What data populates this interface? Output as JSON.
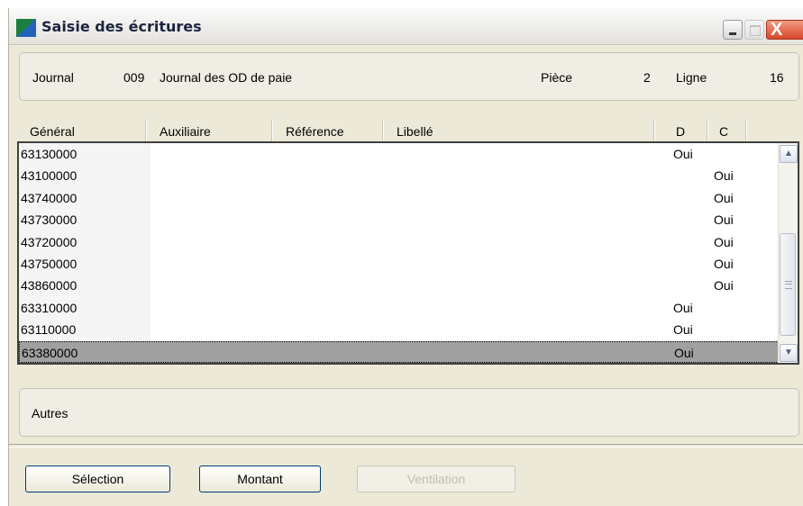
{
  "window": {
    "title": "Saisie des écritures",
    "close_glyph": "X"
  },
  "header": {
    "journal_label": "Journal",
    "journal_code": "009",
    "journal_name": "Journal des OD de paie",
    "piece_label": "Pièce",
    "piece_value": "2",
    "ligne_label": "Ligne",
    "ligne_value": "16"
  },
  "grid": {
    "columns": [
      "Général",
      "Auxiliaire",
      "Référence",
      "Libellé",
      "D",
      "C"
    ],
    "rows": [
      {
        "general": "63130000",
        "d": "Oui",
        "c": ""
      },
      {
        "general": "43100000",
        "d": "",
        "c": "Oui"
      },
      {
        "general": "43740000",
        "d": "",
        "c": "Oui"
      },
      {
        "general": "43730000",
        "d": "",
        "c": "Oui"
      },
      {
        "general": "43720000",
        "d": "",
        "c": "Oui"
      },
      {
        "general": "43750000",
        "d": "",
        "c": "Oui"
      },
      {
        "general": "43860000",
        "d": "",
        "c": "Oui"
      },
      {
        "general": "63310000",
        "d": "Oui",
        "c": ""
      },
      {
        "general": "63110000",
        "d": "Oui",
        "c": ""
      },
      {
        "general": "63380000",
        "d": "Oui",
        "c": ""
      }
    ],
    "selected_row": 9
  },
  "other": {
    "label": "Autres"
  },
  "buttons": {
    "selection": "Sélection",
    "montant": "Montant",
    "ventilation": "Ventilation"
  },
  "icons": [
    "app-icon",
    "minimize-icon",
    "maximize-icon",
    "close-icon",
    "scroll-up-icon",
    "scroll-down-icon"
  ],
  "colors": {
    "close_button": "#d8472b",
    "selected_row": "#a0a0a0",
    "window_bg": "#ece9d8"
  }
}
